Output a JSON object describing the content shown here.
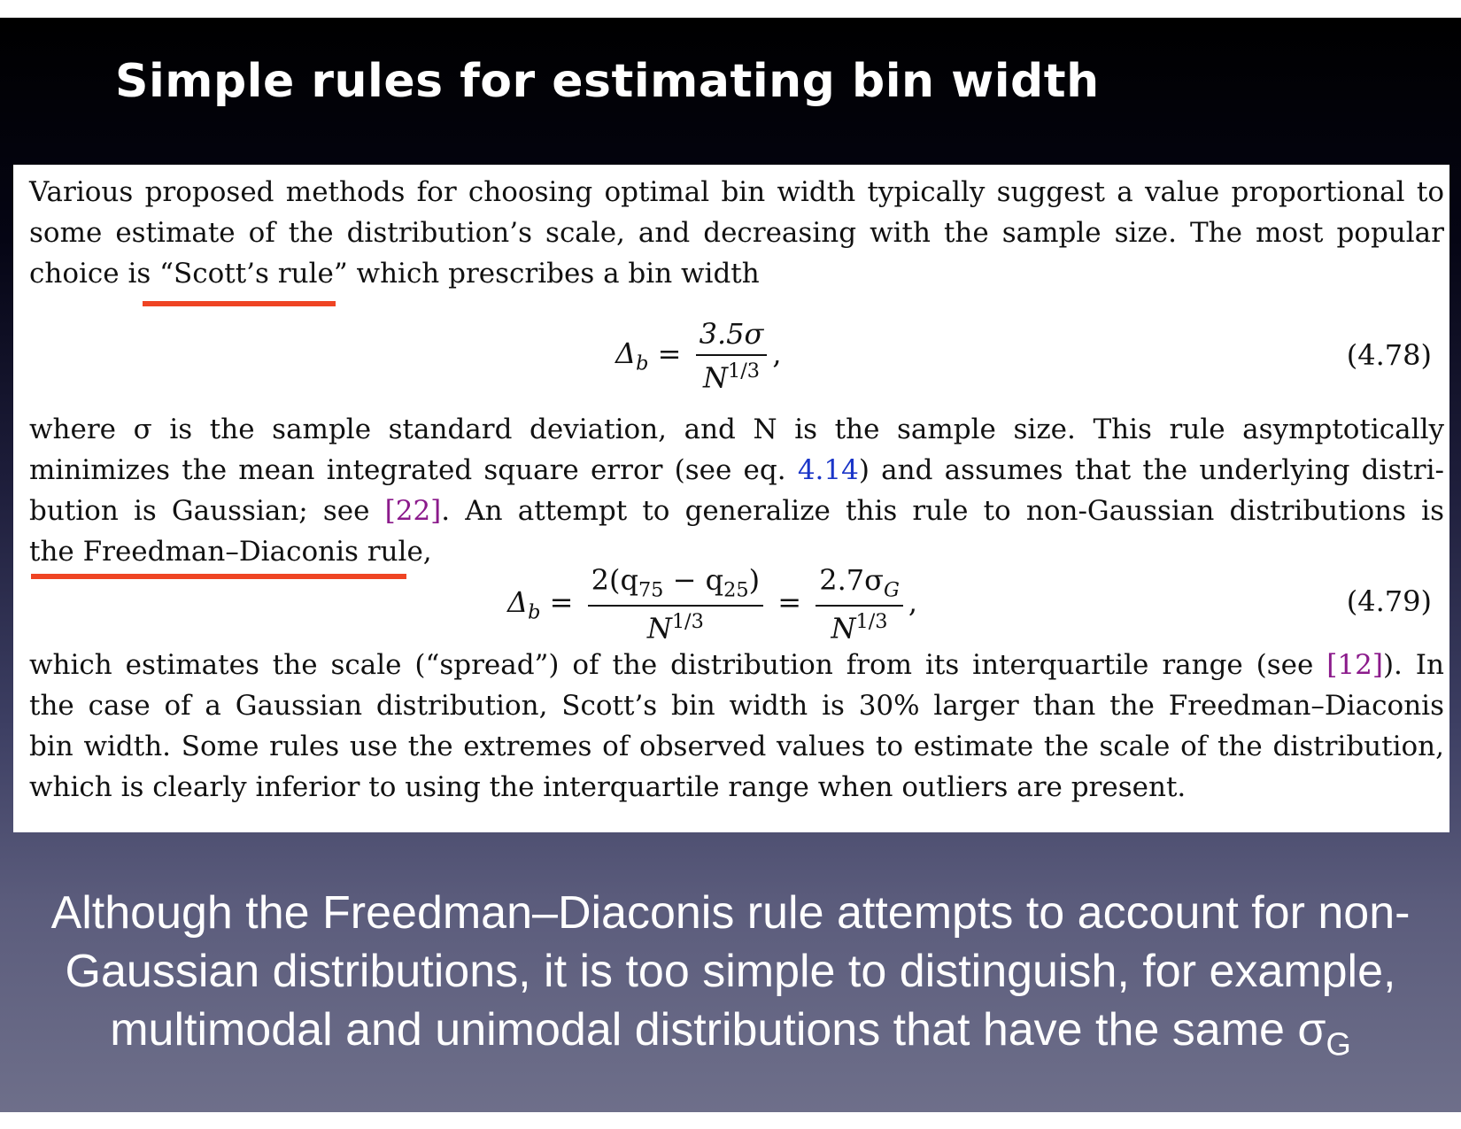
{
  "slide": {
    "title": "Simple rules for estimating bin width",
    "caption_lines": [
      "Although the Freedman–Diaconis rule attempts to account for non-",
      "Gaussian distributions, it is too simple to distinguish, for example,",
      "multimodal and unimodal distributions that have the same σ"
    ],
    "caption_subscript": "G"
  },
  "excerpt": {
    "para1": [
      "Various proposed methods for choosing optimal bin width typically suggest a value proportional to",
      "some estimate of the distribution’s scale, and decreasing with the sample size. The most popular",
      "choice is “Scott’s rule” which prescribes a bin width"
    ],
    "eq1": {
      "lhs": "Δ",
      "lhs_sub": "b",
      "num": "3.5σ",
      "den": "N",
      "den_sup": "1/3",
      "number": "(4.78)"
    },
    "para2": {
      "l1": "where σ is the sample standard deviation, and N is the sample size. This rule asymptotically",
      "l2_a": "minimizes the mean integrated square error (see eq. ",
      "l2_ref": "4.14",
      "l2_b": ") and assumes that the underlying distri-",
      "l3_a": "bution is Gaussian; see ",
      "l3_ref": "[22]",
      "l3_b": ". An attempt to generalize this rule to non-Gaussian distributions is",
      "l4": "the Freedman–Diaconis rule,"
    },
    "eq2": {
      "lhs": "Δ",
      "lhs_sub": "b",
      "num1": "2(q",
      "num1_sub_a": "75",
      "num1_mid": " − q",
      "num1_sub_b": "25",
      "num1_end": ")",
      "den1": "N",
      "den1_sup": "1/3",
      "num2": "2.7σ",
      "num2_sub": "G",
      "den2": "N",
      "den2_sup": "1/3",
      "number": "(4.79)"
    },
    "para3": {
      "l1_a": "which estimates the scale (“spread”) of the distribution from its interquartile range (see ",
      "l1_ref": "[12]",
      "l1_b": "). In",
      "l2": "the case of a Gaussian distribution, Scott’s bin width is 30% larger than the Freedman–Diaconis",
      "l3": "bin width. Some rules use the extremes of observed values to estimate the scale of the distribution,",
      "l4": "which is clearly inferior to using the interquartile range when outliers are present."
    }
  },
  "colors": {
    "highlight_underline": "#ef4423",
    "citation_purple": "#8b1a8b",
    "citation_blue": "#1a35c8"
  }
}
